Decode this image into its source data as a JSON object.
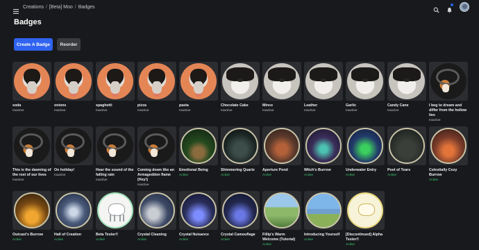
{
  "breadcrumb": [
    "Creations",
    "[Beta] Moo",
    "Badges"
  ],
  "page_title": "Badges",
  "buttons": {
    "create": "Create A Badge",
    "reorder": "Reorder"
  },
  "badges": [
    {
      "name": "soda",
      "status": "Inactive",
      "thumb": "dog-orange"
    },
    {
      "name": "onions",
      "status": "Inactive",
      "thumb": "dog-orange"
    },
    {
      "name": "spaghetti",
      "status": "Inactive",
      "thumb": "dog-orange"
    },
    {
      "name": "pizza",
      "status": "Inactive",
      "thumb": "dog-orange"
    },
    {
      "name": "pasta",
      "status": "Inactive",
      "thumb": "dog-orange"
    },
    {
      "name": "Chocolate Cake",
      "status": "Inactive",
      "thumb": "dog-white"
    },
    {
      "name": "Mince",
      "status": "Inactive",
      "thumb": "dog-white"
    },
    {
      "name": "Leather",
      "status": "Inactive",
      "thumb": "dog-white"
    },
    {
      "name": "Garlic",
      "status": "Inactive",
      "thumb": "dog-white"
    },
    {
      "name": "Candy Cane",
      "status": "Inactive",
      "thumb": "dog-white"
    },
    {
      "name": "I beg to dream and differ from the hollow lies",
      "status": "Inactive",
      "thumb": "dog-dark"
    },
    {
      "name": "This is the dawning of the rest of our lives",
      "status": "Inactive",
      "thumb": "dog-dark"
    },
    {
      "name": "On holiday!",
      "status": "Inactive",
      "thumb": "dog-dark"
    },
    {
      "name": "Hear the sound of the falling rain",
      "status": "Inactive",
      "thumb": "dog-dark"
    },
    {
      "name": "Coming down like an Armageddon flame (Hey!)",
      "status": "Inactive",
      "thumb": "dog-dark"
    },
    {
      "name": "Emotional Being",
      "status": "Active",
      "thumb": "s-green"
    },
    {
      "name": "Shimmering Quartz",
      "status": "Active",
      "thumb": "s-dark"
    },
    {
      "name": "Aperture Pond",
      "status": "Active",
      "thumb": "s-pond"
    },
    {
      "name": "Witch's Burrow",
      "status": "Active",
      "thumb": "s-witch"
    },
    {
      "name": "Underwater Entry",
      "status": "Active",
      "thumb": "s-under"
    },
    {
      "name": "Pool of Tears",
      "status": "Active",
      "thumb": "s-pool"
    },
    {
      "name": "Celestially Cozy Burrow",
      "status": "Active",
      "thumb": "s-cozy"
    },
    {
      "name": "Outcast's Burrow",
      "status": "Active",
      "thumb": "s-outcast"
    },
    {
      "name": "Hall of Creation",
      "status": "Active",
      "thumb": "s-hall"
    },
    {
      "name": "Beta Tester!!",
      "status": "Active",
      "thumb": "s-beta"
    },
    {
      "name": "Crystal Cleaning",
      "status": "Active",
      "thumb": "s-clean"
    },
    {
      "name": "Crystal Nuisance",
      "status": "Active",
      "thumb": "s-nuis"
    },
    {
      "name": "Crystal Camouflage",
      "status": "Active",
      "thumb": "s-camo"
    },
    {
      "name": "Fillip's Warm Welcome (Tutorial)",
      "status": "Active",
      "thumb": "s-fillip"
    },
    {
      "name": "Introducing Yourself",
      "status": "Active",
      "thumb": "s-intro"
    },
    {
      "name": "[Discontinued] Alpha Tester!!",
      "status": "Active",
      "thumb": "s-alpha"
    }
  ],
  "icons": {
    "menu": "sidebar-toggle-icon",
    "search": "search-icon",
    "notifications": "bell-icon",
    "avatar": "avatar"
  },
  "colors": {
    "accent": "#2f63f0",
    "active": "#3dcc74",
    "background": "#18191c"
  }
}
